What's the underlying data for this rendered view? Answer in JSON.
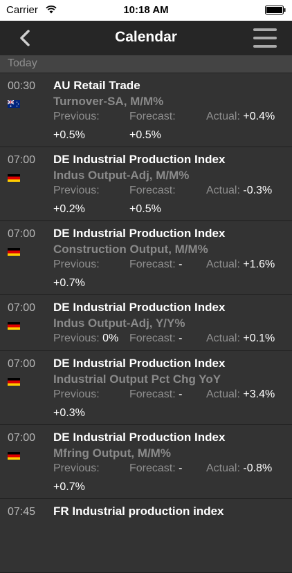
{
  "status_bar": {
    "carrier": "Carrier",
    "time": "10:18 AM"
  },
  "nav": {
    "title": "Calendar",
    "back_icon": "chevron-left-icon",
    "menu_icon": "hamburger-menu-icon"
  },
  "section": {
    "label": "Today"
  },
  "labels": {
    "previous": "Previous:",
    "forecast": "Forecast:",
    "actual": "Actual:"
  },
  "events": [
    {
      "time": "00:30",
      "country": "AU",
      "name": "AU Retail Trade",
      "subtitle": "Turnover-SA, M/M%",
      "previous": "+0.5%",
      "forecast": "+0.5%",
      "actual": "+0.4%"
    },
    {
      "time": "07:00",
      "country": "DE",
      "name": "DE Industrial Production Index",
      "subtitle": "Indus Output-Adj, M/M%",
      "previous": "+0.2%",
      "forecast": "+0.5%",
      "actual": "-0.3%"
    },
    {
      "time": "07:00",
      "country": "DE",
      "name": "DE Industrial Production Index",
      "subtitle": "Construction Output, M/M%",
      "previous": "+0.7%",
      "forecast": "-",
      "actual": "+1.6%"
    },
    {
      "time": "07:00",
      "country": "DE",
      "name": "DE Industrial Production Index",
      "subtitle": "Indus Output-Adj, Y/Y%",
      "previous": "0%",
      "forecast": "-",
      "actual": "+0.1%"
    },
    {
      "time": "07:00",
      "country": "DE",
      "name": "DE Industrial Production Index",
      "subtitle": "Industrial Output Pct Chg YoY",
      "previous": "+0.3%",
      "forecast": "-",
      "actual": "+3.4%"
    },
    {
      "time": "07:00",
      "country": "DE",
      "name": "DE Industrial Production Index",
      "subtitle": "Mfring Output, M/M%",
      "previous": "+0.7%",
      "forecast": "-",
      "actual": "-0.8%"
    },
    {
      "time": "07:45",
      "country": "FR",
      "name": "FR Industrial production index"
    }
  ]
}
